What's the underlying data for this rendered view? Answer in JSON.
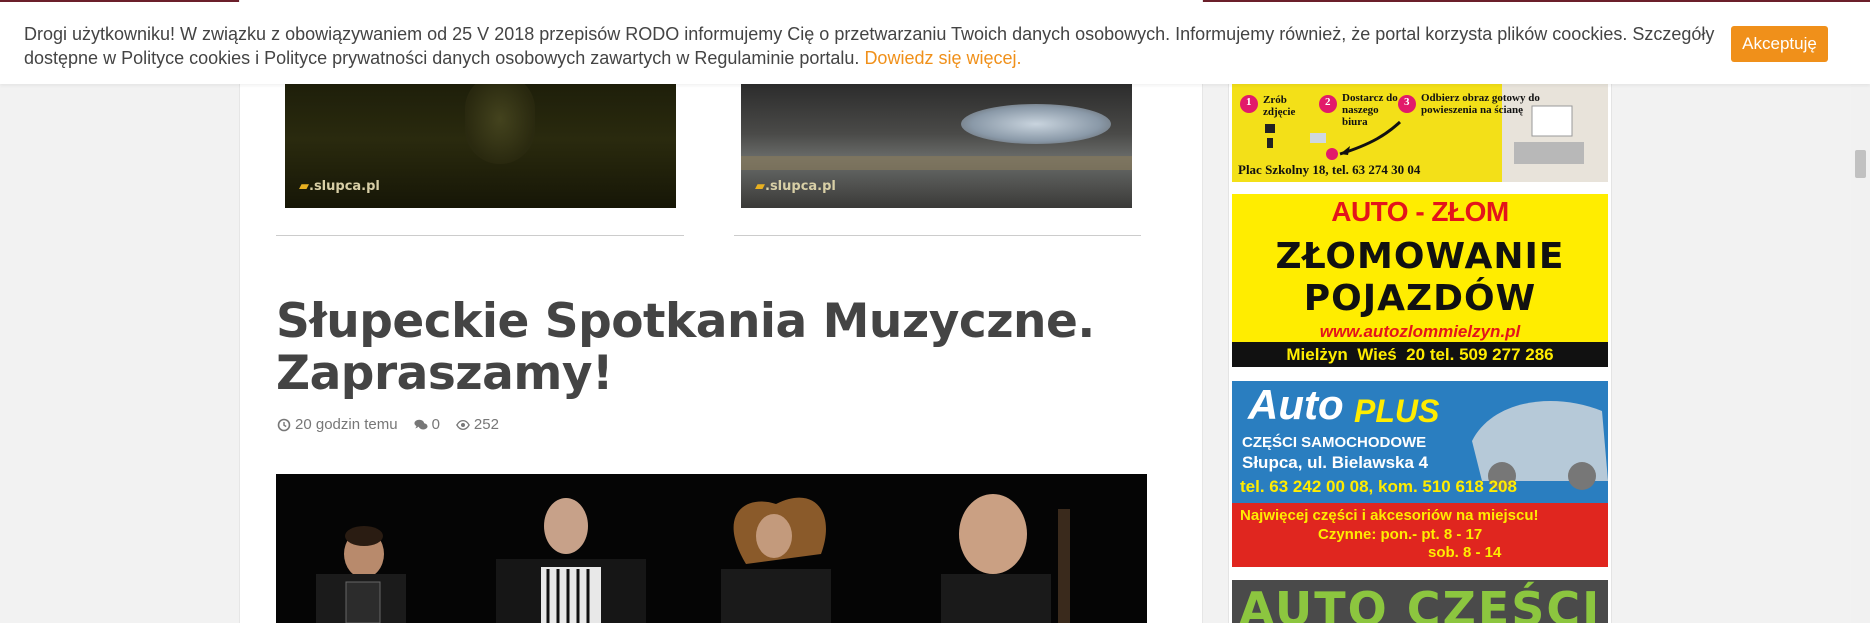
{
  "cookie": {
    "message": "Drogi użytkowniku! W związku z obowiązywaniem od 25 V 2018 przepisów RODO informujemy Cię o przetwarzaniu Twoich danych osobowych. Informujemy również, że portal korzysta plików coockies. Szczegóły dostępne w Polityce cookies i Polityce prywatności danych osobowych zawartych w Regulaminie portalu.",
    "link": "Dowiedz się więcej.",
    "accept": "Akceptuję"
  },
  "thumbs": [
    {
      "watermark": ".slupca.pl"
    },
    {
      "watermark": ".slupca.pl"
    }
  ],
  "article": {
    "title": "Słupeckie Spotkania Muzyczne. Zapraszamy!",
    "time": "20 godzin temu",
    "comments": "0",
    "views": "252"
  },
  "ads": {
    "photo": {
      "step1": "Zrób zdjęcie",
      "step2": "Dostarcz do naszego biura",
      "step3": "Odbierz obraz gotowy do powieszenia na ścianę",
      "footer": "Plac Szkolny 18, tel. 63 274 30 04",
      "num1": "1",
      "num2": "2",
      "num3": "3"
    },
    "zlom": {
      "brand": "AUTO - ZŁOM",
      "line1": "ZŁOMOWANIE",
      "line2": "POJAZDÓW",
      "url": "www.autozlommielzyn.pl",
      "footer": "Mielżyn  Wieś  20 tel. 509 277 286"
    },
    "autoplus": {
      "brand1": "Auto",
      "brand2": "PLUS",
      "sub": "CZĘŚCI SAMOCHODOWE",
      "address": "Słupca, ul. Bielawska 4",
      "phone": "tel. 63 242 00 08, kom. 510 618 208",
      "promo": "Najwięcej części i akcesoriów na miejscu!",
      "hours1": "Czynne: pon.- pt. 8 - 17",
      "hours2": "sob. 8 - 14"
    },
    "czesci": {
      "title": "AUTO CZĘŚCI"
    }
  }
}
